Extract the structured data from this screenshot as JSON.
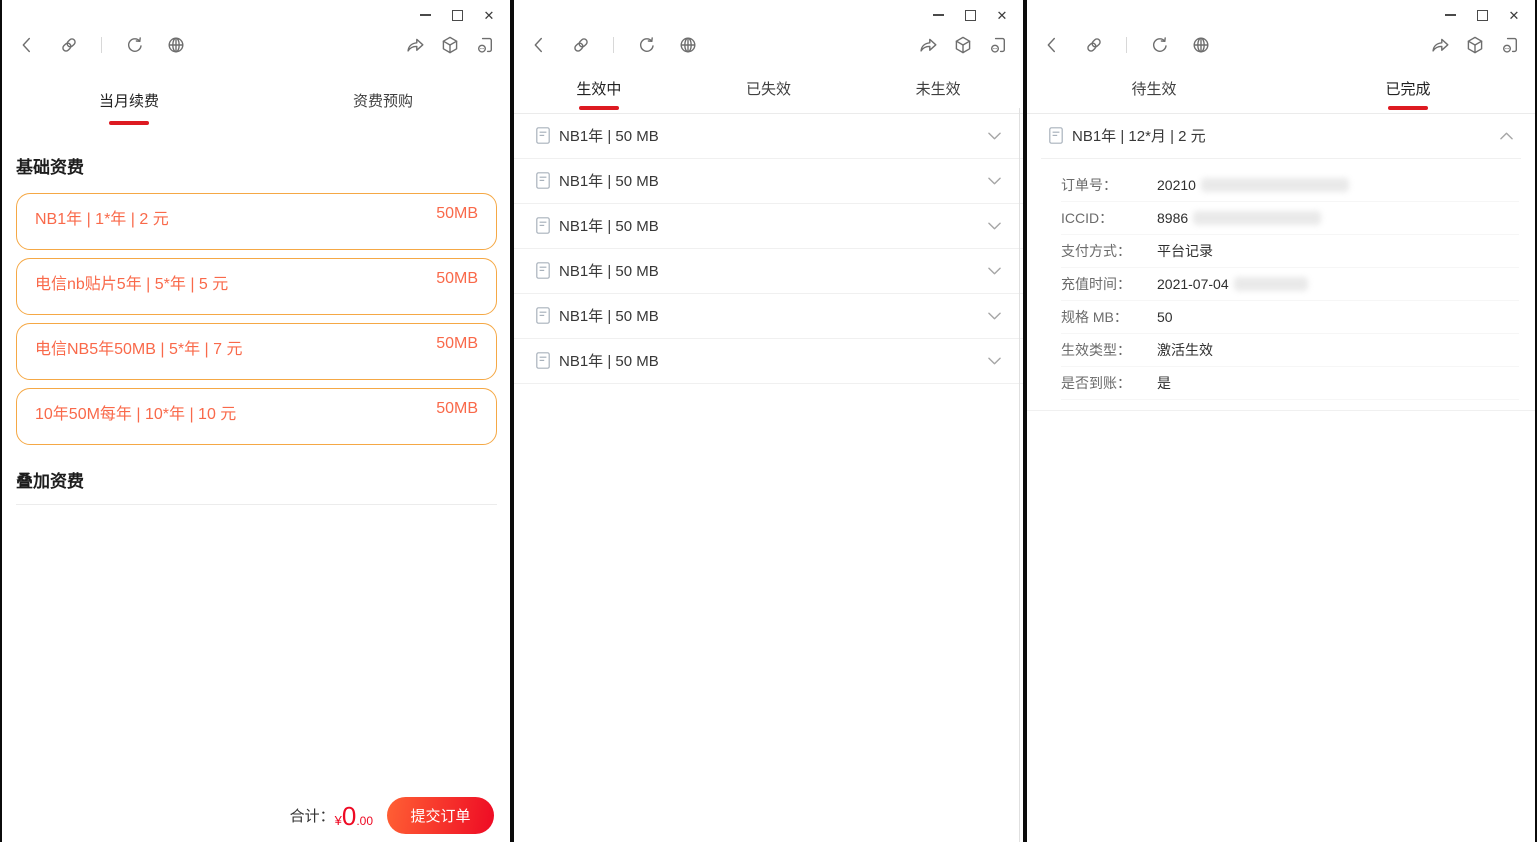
{
  "chrome": {
    "minimize_label": "minimize",
    "maximize_label": "maximize",
    "close_glyph": "✕"
  },
  "colors": {
    "accent_red": "#dd1a21",
    "price_red": "#ee0a24",
    "button_gradient_start": "#ff6034",
    "button_gradient_end": "#ee0a24",
    "card_border_orange": "#f5a845",
    "card_text_orange": "#f9694a"
  },
  "windows": [
    {
      "name": "renewal",
      "tabs": [
        {
          "label": "当月续费",
          "active": true
        },
        {
          "label": "资费预购",
          "active": false
        }
      ],
      "sections": [
        {
          "title": "基础资费"
        },
        {
          "title": "叠加资费"
        }
      ],
      "cards": [
        {
          "name": "NB1年 | 1*年 | 2 元",
          "size": "50MB"
        },
        {
          "name": "电信nb贴片5年 | 5*年 | 5 元",
          "size": "50MB"
        },
        {
          "name": "电信NB5年50MB | 5*年 | 7 元",
          "size": "50MB"
        },
        {
          "name": "10年50M每年 | 10*年 | 10 元",
          "size": "50MB"
        }
      ],
      "footer": {
        "total_label": "合计：",
        "currency": "¥",
        "amount_int": "0",
        "amount_dec": ".00",
        "submit": "提交订单"
      }
    },
    {
      "name": "effective-list",
      "tabs": [
        {
          "label": "生效中",
          "active": true
        },
        {
          "label": "已失效",
          "active": false
        },
        {
          "label": "未生效",
          "active": false
        }
      ],
      "items": [
        "NB1年 | 50 MB",
        "NB1年 | 50 MB",
        "NB1年 | 50 MB",
        "NB1年 | 50 MB",
        "NB1年 | 50 MB",
        "NB1年 | 50 MB"
      ]
    },
    {
      "name": "orders",
      "tabs": [
        {
          "label": "待生效",
          "active": false
        },
        {
          "label": "已完成",
          "active": true
        }
      ],
      "expanded_item": {
        "title": "NB1年 | 12*月 | 2 元",
        "details": [
          {
            "label": "订单号：",
            "value": "20210",
            "redacted": true
          },
          {
            "label": "ICCID：",
            "value": "8986",
            "redacted": true
          },
          {
            "label": "支付方式：",
            "value": "平台记录",
            "redacted": false
          },
          {
            "label": "充值时间：",
            "value": "2021-07-04",
            "redacted": true
          },
          {
            "label": "规格 MB：",
            "value": "50",
            "redacted": false
          },
          {
            "label": "生效类型：",
            "value": "激活生效",
            "redacted": false
          },
          {
            "label": "是否到账：",
            "value": "是",
            "redacted": false
          }
        ]
      }
    }
  ]
}
